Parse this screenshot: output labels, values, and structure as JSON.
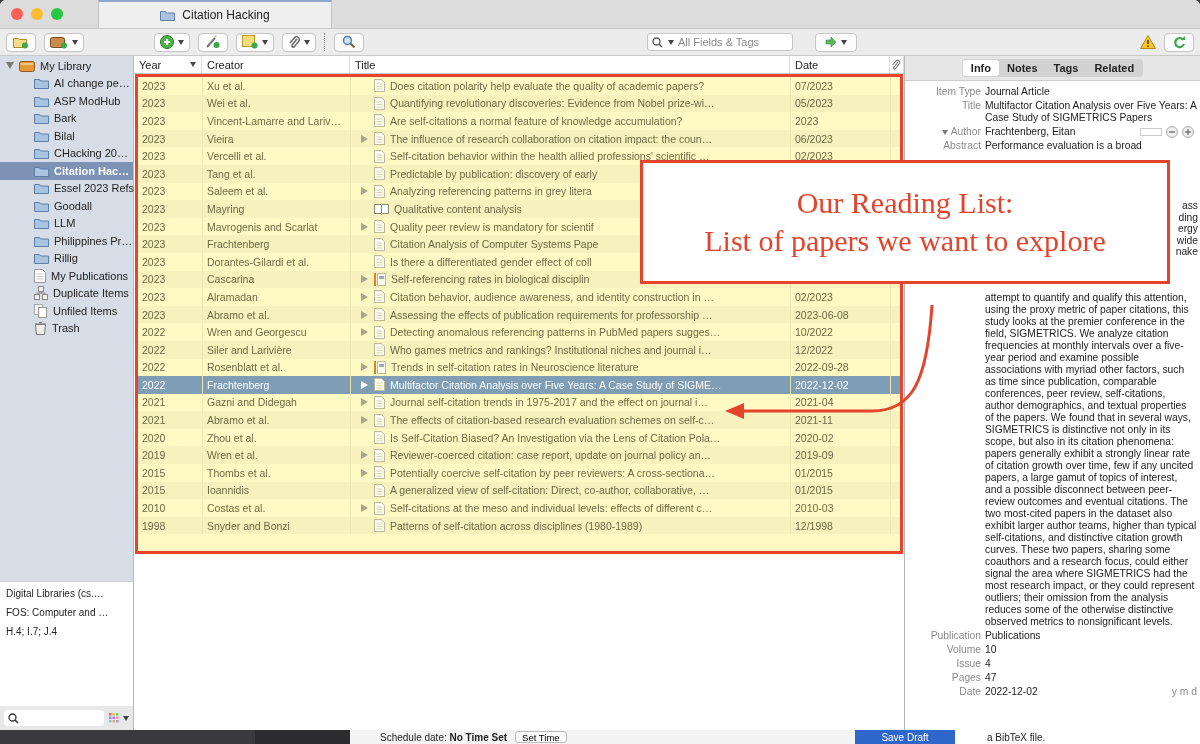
{
  "window": {
    "tab_title": "Citation Hacking"
  },
  "toolbar": {
    "search": {
      "placeholder": "All Fields & Tags"
    }
  },
  "sidebar": {
    "items": [
      {
        "label": "My Library",
        "kind": "library",
        "selected": false,
        "expanded": true,
        "children": [
          {
            "label": "AI change pe…",
            "kind": "folder",
            "selected": false
          },
          {
            "label": "ASP ModHub",
            "kind": "folder",
            "selected": false
          },
          {
            "label": "Bark",
            "kind": "folder",
            "selected": false
          },
          {
            "label": "Bilal",
            "kind": "folder",
            "selected": false
          },
          {
            "label": "CHacking 20…",
            "kind": "folder",
            "selected": false
          },
          {
            "label": "Citation Hac…",
            "kind": "folder",
            "selected": true
          },
          {
            "label": "Essel 2023 Refs",
            "kind": "folder",
            "selected": false
          },
          {
            "label": "Goodall",
            "kind": "folder",
            "selected": false
          },
          {
            "label": "LLM",
            "kind": "folder",
            "selected": false
          },
          {
            "label": "Philippines Pr…",
            "kind": "folder",
            "selected": false
          },
          {
            "label": "Rillig",
            "kind": "folder",
            "selected": false
          },
          {
            "label": "My Publications",
            "kind": "publications",
            "selected": false
          },
          {
            "label": "Duplicate Items",
            "kind": "duplicates",
            "selected": false
          },
          {
            "label": "Unfiled Items",
            "kind": "unfiled",
            "selected": false
          },
          {
            "label": "Trash",
            "kind": "trash",
            "selected": false
          }
        ]
      }
    ],
    "tags": [
      "Digital Libraries (cs.…",
      "FOS: Computer and …",
      "H.4; I.7; J.4"
    ]
  },
  "table": {
    "columns": [
      {
        "label": "Year",
        "sorted": true
      },
      {
        "label": "Creator",
        "sorted": false
      },
      {
        "label": "Title",
        "sorted": false
      },
      {
        "label": "Date",
        "sorted": false
      }
    ],
    "rows": [
      {
        "year": "2023",
        "creator": "Xu et al.",
        "title": "Does citation polarity help evaluate the quality of academic papers?",
        "date": "07/2023",
        "kind": "article",
        "has_children": false,
        "selected": false
      },
      {
        "year": "2023",
        "creator": "Wei et al.",
        "title": "Quantifying revolutionary discoveries: Evidence from Nobel prize-wi…",
        "date": "05/2023",
        "kind": "article",
        "has_children": false,
        "selected": false
      },
      {
        "year": "2023",
        "creator": "Vincent-Lamarre and Lariv…",
        "title": "Are self-citations a normal feature of knowledge accumulation?",
        "date": "2023",
        "kind": "article",
        "has_children": false,
        "selected": false
      },
      {
        "year": "2023",
        "creator": "Vieira",
        "title": "The influence of research collaboration on citation impact: the coun…",
        "date": "06/2023",
        "kind": "article",
        "has_children": true,
        "selected": false
      },
      {
        "year": "2023",
        "creator": "Vercelli et al.",
        "title": "Self-citation behavior within the health allied professions' scientific …",
        "date": "02/2023",
        "kind": "article",
        "has_children": false,
        "selected": false
      },
      {
        "year": "2023",
        "creator": "Tang et al.",
        "title": "Predictable by publication: discovery of early",
        "kind": "article",
        "has_children": false,
        "selected": false
      },
      {
        "year": "2023",
        "creator": "Saleem et al.",
        "title": "Analyzing referencing patterns in grey litera",
        "kind": "article",
        "has_children": true,
        "selected": false
      },
      {
        "year": "2023",
        "creator": "Mayring",
        "title": "Qualitative content analysis",
        "kind": "book",
        "has_children": false,
        "selected": false
      },
      {
        "year": "2023",
        "creator": "Mavrogenis and Scarlat",
        "title": "Quality peer review is mandatory for scientif",
        "kind": "article",
        "has_children": true,
        "selected": false
      },
      {
        "year": "2023",
        "creator": "Frachtenberg",
        "title": "Citation Analysis of Computer Systems Pape",
        "kind": "article",
        "has_children": false,
        "selected": false
      },
      {
        "year": "2023",
        "creator": "Dorantes-Gilardi et al.",
        "title": "Is there a differentiated gender effect of coll",
        "kind": "article",
        "has_children": false,
        "selected": false
      },
      {
        "year": "2023",
        "creator": "Cascarina",
        "title": "Self-referencing rates in biological disciplin",
        "kind": "preprint",
        "has_children": true,
        "selected": false
      },
      {
        "year": "2023",
        "creator": "Alramadan",
        "title": "Citation behavior, audience awareness, and identity construction in …",
        "date": "02/2023",
        "kind": "article",
        "has_children": true,
        "selected": false
      },
      {
        "year": "2023",
        "creator": "Abramo et al.",
        "title": "Assessing the effects of publication requirements for professorship …",
        "date": "2023-06-08",
        "kind": "article",
        "has_children": true,
        "selected": false
      },
      {
        "year": "2022",
        "creator": "Wren and Georgescu",
        "title": "Detecting anomalous referencing patterns in PubMed papers sugges…",
        "date": "10/2022",
        "kind": "article",
        "has_children": true,
        "selected": false
      },
      {
        "year": "2022",
        "creator": "Siler and Larivière",
        "title": "Who games metrics and rankings? Institutional niches and journal i…",
        "date": "12/2022",
        "kind": "article",
        "has_children": false,
        "selected": false
      },
      {
        "year": "2022",
        "creator": "Rosenblatt et al.",
        "title": "Trends in self-citation rates in Neuroscience literature",
        "date": "2022-09-28",
        "kind": "preprint",
        "has_children": true,
        "selected": false
      },
      {
        "year": "2022",
        "creator": "Frachtenberg",
        "title": "Multifactor Citation Analysis over Five Years: A Case Study of SIGME…",
        "date": "2022-12-02",
        "kind": "article",
        "has_children": true,
        "selected": true
      },
      {
        "year": "2021",
        "creator": "Gazni and Didegah",
        "title": "Journal self-citation trends in 1975-2017 and the effect on journal i…",
        "date": "2021-04",
        "kind": "article",
        "has_children": true,
        "selected": false
      },
      {
        "year": "2021",
        "creator": "Abramo et al.",
        "title": "The effects of citation-based research evaluation schemes on self-c…",
        "date": "2021-11",
        "kind": "article",
        "has_children": true,
        "selected": false
      },
      {
        "year": "2020",
        "creator": "Zhou et al.",
        "title": "Is Self-Citation Biased? An Investigation via the Lens of Citation Pola…",
        "date": "2020-02",
        "kind": "article",
        "has_children": false,
        "selected": false
      },
      {
        "year": "2019",
        "creator": "Wren et al.",
        "title": "Reviewer-coerced citation: case report, update on journal policy an…",
        "date": "2019-09",
        "kind": "article",
        "has_children": true,
        "selected": false
      },
      {
        "year": "2015",
        "creator": "Thombs et al.",
        "title": "Potentially coercive self-citation by peer reviewers: A cross-sectiona…",
        "date": "01/2015",
        "kind": "article",
        "has_children": true,
        "selected": false
      },
      {
        "year": "2015",
        "creator": "Ioannidis",
        "title": "A generalized view of self-citation: Direct, co-author, collaborative, …",
        "date": "01/2015",
        "kind": "article",
        "has_children": false,
        "selected": false
      },
      {
        "year": "2010",
        "creator": "Costas et al.",
        "title": "Self-citations at the meso and individual levels: effects of different c…",
        "date": "2010-03",
        "kind": "article",
        "has_children": true,
        "selected": false
      },
      {
        "year": "1998",
        "creator": "Snyder and Bonzi",
        "title": "Patterns of self-citation across disciplines (1980-1989)",
        "date": "12/1998",
        "kind": "article",
        "has_children": false,
        "selected": false
      }
    ]
  },
  "callout": {
    "lines": [
      "Our Reading List:",
      "List of papers we want to explore"
    ]
  },
  "item_pane": {
    "tabs": [
      {
        "label": "Info",
        "selected": true
      },
      {
        "label": "Notes",
        "selected": false
      },
      {
        "label": "Tags",
        "selected": false
      },
      {
        "label": "Related",
        "selected": false
      }
    ],
    "fields": [
      {
        "kind": "plain",
        "label": "Item Type",
        "value": "Journal Article"
      },
      {
        "kind": "plain",
        "label": "Title",
        "value": "Multifactor Citation Analysis over Five Years: A Case Study of SIGMETRICS Papers"
      },
      {
        "kind": "author",
        "label": "Author",
        "value": "Frachtenberg, Eitan",
        "expanded": true
      },
      {
        "kind": "abstract",
        "label": "Abstract",
        "value": "Performance evaluation is a broad",
        "fragments": [
          "ass",
          "ding",
          "ergy",
          "wide",
          "nake"
        ],
        "continuation": "attempt to quantify and qualify this attention, using the proxy metric of paper citations, this study looks at the premier conference in the field, SIGMETRICS. We analyze citation frequencies at monthly intervals over a five-year period and examine possible associations with myriad other factors, such as time since publication, comparable conferences, peer review, self-citations, author demographics, and textual properties of the papers. We found that in several ways, SIGMETRICS is distinctive not only in its scope, but also in its citation phenomena: papers generally exhibit a strongly linear rate of citation growth over time, few if any uncited papers, a large gamut of topics of interest, and a possible disconnect between peer-review outcomes and eventual citations. The two most-cited papers in the dataset also exhibit larger author teams, higher than typical self-citations, and distinctive citation growth curves. These two papers, sharing some coauthors and a research focus, could either signal the area where SIGMETRICS had the most research impact, or they could represent outliers; their omission from the analysis reduces some of the otherwise distinctive observed metrics to nonsignificant levels."
      },
      {
        "kind": "plain",
        "label": "Publication",
        "value": "Publications"
      },
      {
        "kind": "plain",
        "label": "Volume",
        "value": "10"
      },
      {
        "kind": "plain",
        "label": "Issue",
        "value": "4"
      },
      {
        "kind": "plain",
        "label": "Pages",
        "value": "47"
      },
      {
        "kind": "date",
        "label": "Date",
        "value": "2022-12-02",
        "hint": "y m d"
      }
    ]
  },
  "background_window": {
    "schedule": "Schedule date: **No Time Set**",
    "set_time": "Set Time",
    "save_draft": "Save Draft",
    "note": "a BibTeX file."
  }
}
